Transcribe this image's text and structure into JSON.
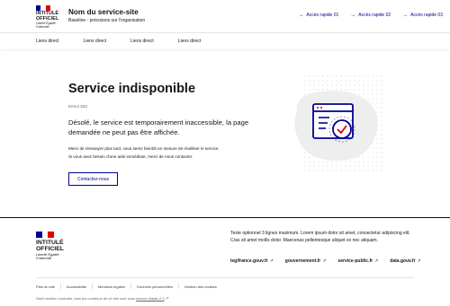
{
  "header": {
    "logo_text": "INTITULÉ OFFICIEL",
    "logo_motto": "Liberté Égalité Fraternité",
    "site_name": "Nom du service-site",
    "tagline": "Baseline - précisions sur l'organisation",
    "quick_links": [
      {
        "label": "Accès rapide 01",
        "icon": "arrow-right-icon"
      },
      {
        "label": "Accès rapide 02",
        "icon": "arrow-right-icon"
      },
      {
        "label": "Accès rapide 03",
        "icon": "arrow-right-icon"
      }
    ]
  },
  "nav": {
    "items": [
      "Liens direct",
      "Liens direct",
      "Liens direct",
      "Liens direct"
    ]
  },
  "main": {
    "title": "Service indisponible",
    "error_code": "Erreur 503",
    "lead": "Désolé, le service est temporairement inaccessible, la page demandée ne peut pas être affichée.",
    "body_line1": "Merci de réessayer plus tard, vous serez bientôt en mesure de réutiliser le service.",
    "body_line2": "Si vous avez besoin d'une aide immédiate, merci de nous contacter.",
    "contact_button": "Contactez-nous"
  },
  "footer": {
    "logo_text": "INTITULÉ OFFICIEL",
    "logo_motto": "Liberté Égalité Fraternité",
    "description": "Texte optionnel 3 lignes maximum. Lorem ipsum dolor sit amet, consectetur adipiscing elit. Cras sit amet mollis dolor. Maecenas pellentesque aliquet ex nec aliquam.",
    "links": [
      "legifrance.gouv.fr",
      "gouvernement.fr",
      "service-public.fr",
      "data.gouv.fr"
    ],
    "bottom_links": [
      "Plan du site",
      "Accessibilité",
      "Mentions légales",
      "Données personnelles",
      "Gestion des cookies"
    ],
    "license_prefix": "Sauf mention contraire, tous les contenus de ce site sont sous",
    "license_link": "licence etalab-2.0"
  },
  "colors": {
    "blue_france": "#000091",
    "red_marianne": "#e1000f",
    "illustration_bg": "#f0f0f0"
  }
}
